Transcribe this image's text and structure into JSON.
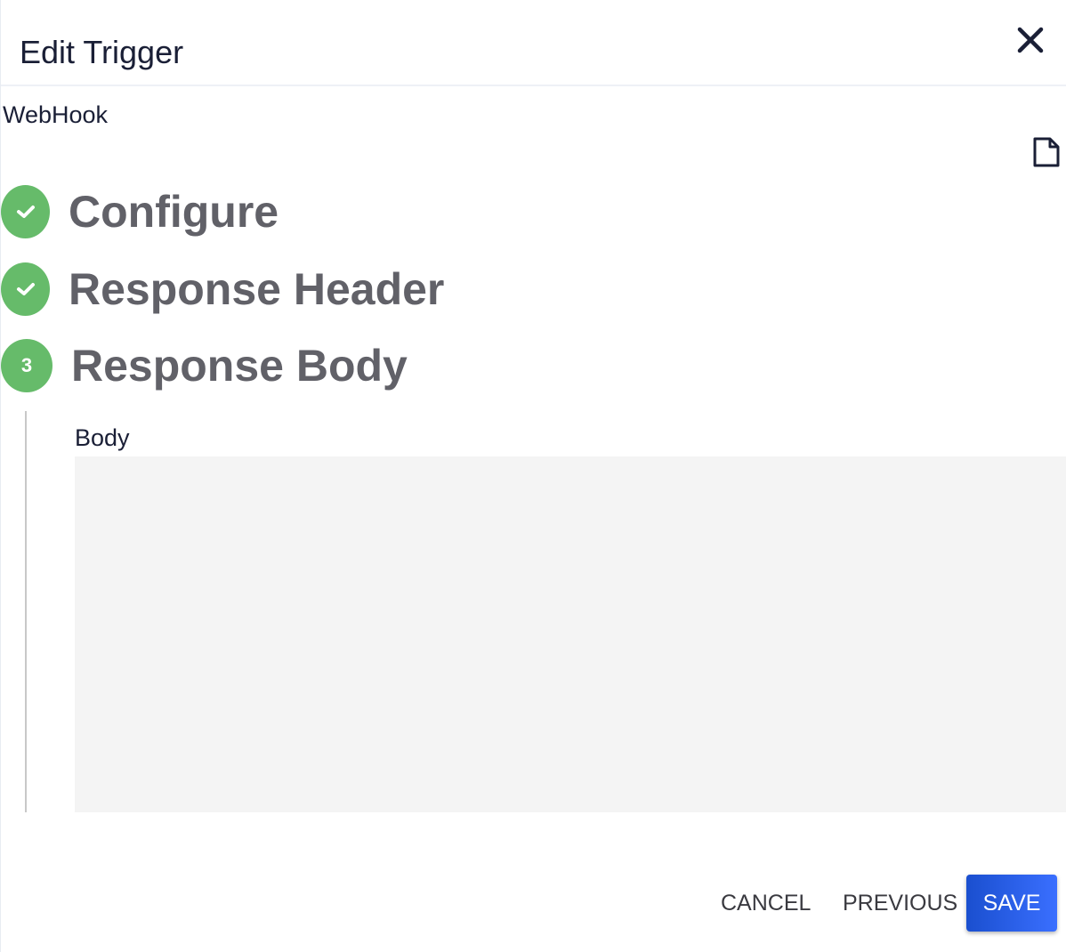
{
  "dialog": {
    "title": "Edit Trigger",
    "close_icon": "close-icon"
  },
  "trigger_type": "WebHook",
  "document_icon": "document-icon",
  "steps": [
    {
      "label": "Configure",
      "state": "complete",
      "icon": "check-icon"
    },
    {
      "label": "Response Header",
      "state": "complete",
      "icon": "check-icon"
    },
    {
      "label": "Response Body",
      "state": "active",
      "number": "3"
    }
  ],
  "body": {
    "label": "Body",
    "value": ""
  },
  "actions": {
    "cancel": "CANCEL",
    "previous": "PREVIOUS",
    "save": "SAVE"
  },
  "colors": {
    "step_complete": "#66bb6a",
    "primary": "#1a4fcf"
  }
}
